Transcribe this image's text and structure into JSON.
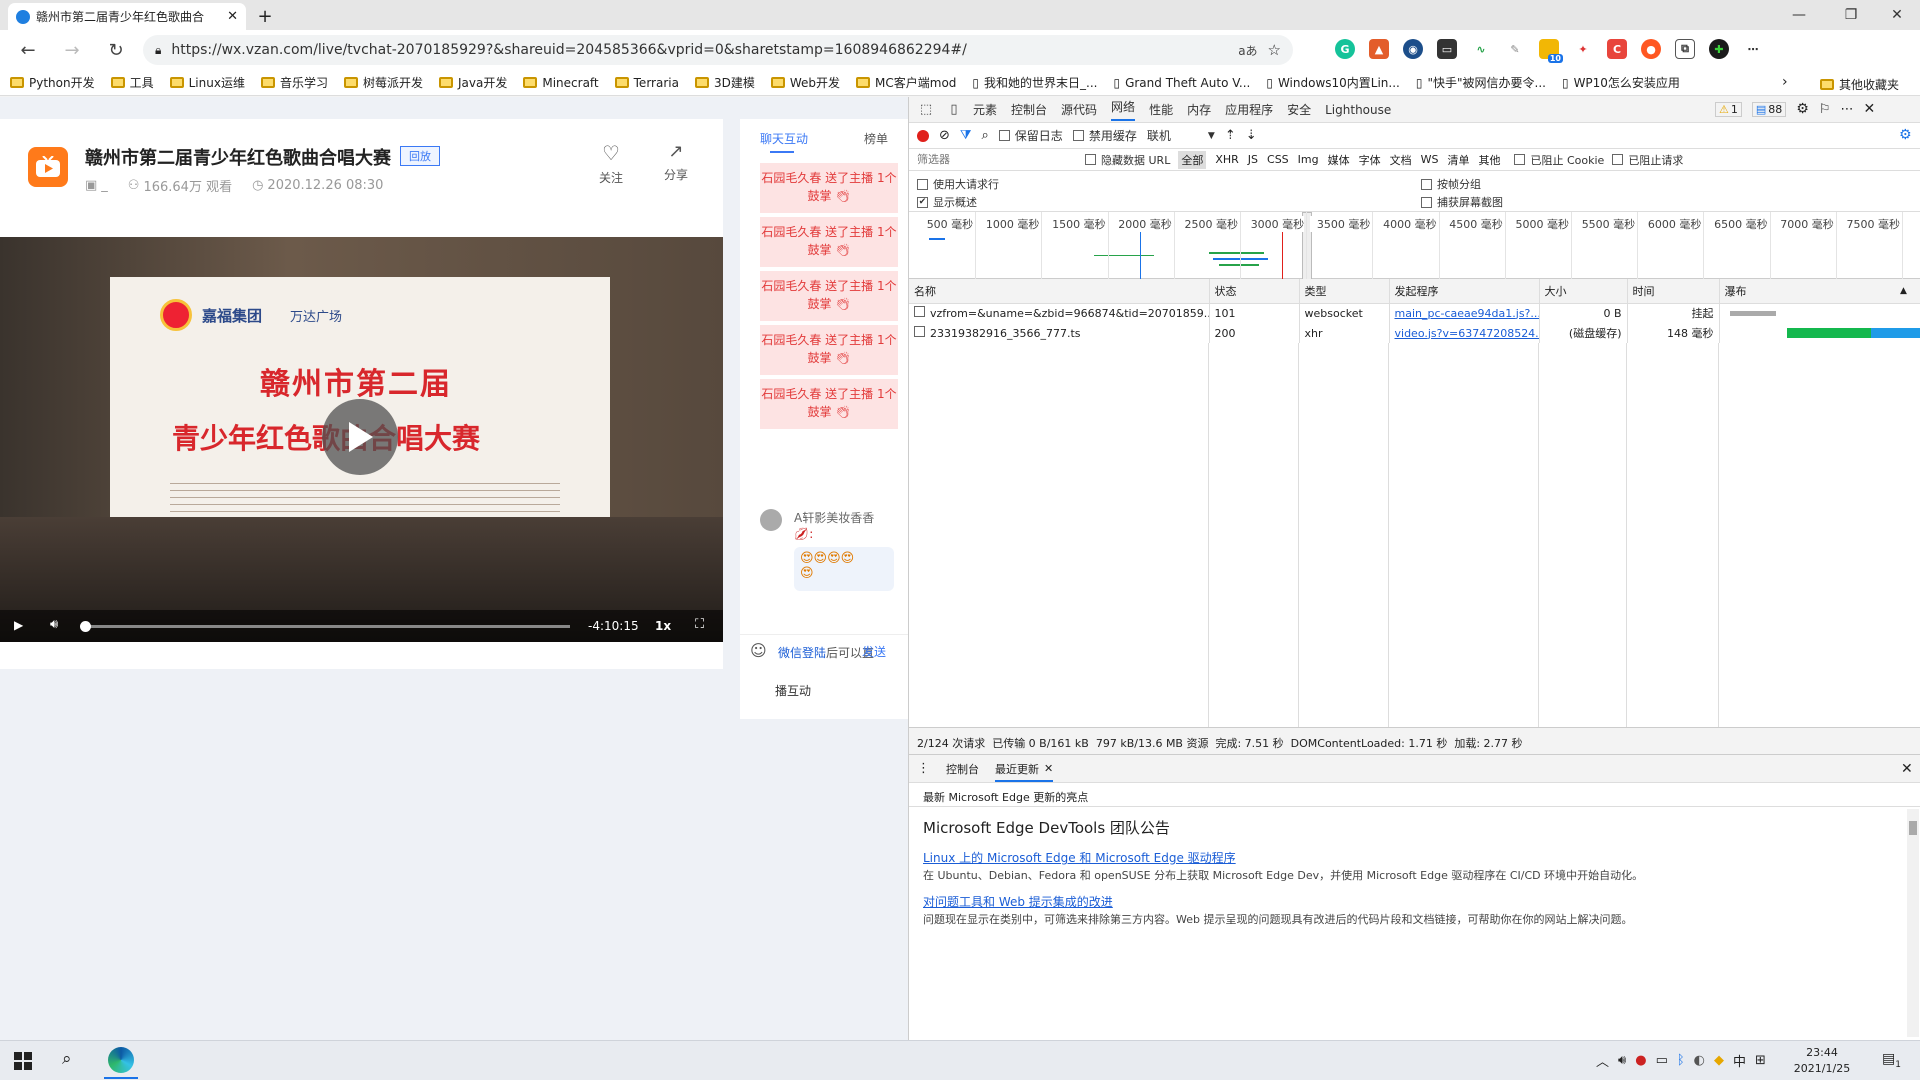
{
  "browser": {
    "tab_title": "赣州市第二届青少年红色歌曲合",
    "url": "https://wx.vzan.com/live/tvchat-2070185929?&shareuid=204585366&vprid=0&sharetstamp=1608946862294#/",
    "bookmarks": [
      "Python开发",
      "工具",
      "Linux运维",
      "音乐学习",
      "树莓派开发",
      "Java开发",
      "Minecraft",
      "Terraria",
      "3D建模",
      "Web开发",
      "MC客户端mod",
      "我和她的世界末日_...",
      "Grand Theft Auto V...",
      "Windows10内置Lin...",
      "\"快手\"被网信办要令...",
      "WP10怎么安装应用"
    ],
    "bookmarks_other": "其他收藏夹",
    "ext_badge": "10",
    "read_icon": "aあ"
  },
  "video_page": {
    "title": "赣州市第二届青少年红色歌曲合唱大赛",
    "badge": "回放",
    "author": "_",
    "views": "166.64万 观看",
    "date": "2020.12.26 08:30",
    "follow": "关注",
    "share": "分享",
    "board_line1": "赣州市第二届",
    "board_line2": "青少年红色歌曲合唱大赛",
    "board_logo1": "嘉福集团",
    "board_logo2": "万达广场",
    "time_left": "-4:10:15",
    "speed": "1x",
    "progress": 0.0
  },
  "chat": {
    "tab_chat": "聊天互动",
    "tab_rank": "榜单",
    "gift_text": "石园毛久春 送了主播 1个 鼓掌",
    "gifts_count": 5,
    "user_name": "A轩影美妆香香",
    "login_prompt": "微信登陆后可以直",
    "login_link": "微信登陆",
    "send": "发送",
    "interaction": "播互动"
  },
  "devtools": {
    "tabs": [
      "元素",
      "控制台",
      "源代码",
      "网络",
      "性能",
      "内存",
      "应用程序",
      "安全",
      "Lighthouse"
    ],
    "active_tab": "网络",
    "warnings": "1",
    "messages": "88",
    "toolbar": {
      "preserve_log": "保留日志",
      "disable_cache": "禁用缓存",
      "throttle": "联机"
    },
    "filter_placeholder": "筛选器",
    "hide_data_url": "隐藏数据 URL",
    "types": [
      "全部",
      "XHR",
      "JS",
      "CSS",
      "Img",
      "媒体",
      "字体",
      "文档",
      "WS",
      "清单",
      "其他"
    ],
    "blocked_cookies": "已阻止 Cookie",
    "blocked_requests": "已阻止请求",
    "large_rows": "使用大请求行",
    "group_by_frame": "按帧分组",
    "show_overview": "显示概述",
    "capture_screenshots": "捕获屏幕截图",
    "timeline_ticks": [
      "500 毫秒",
      "1000 毫秒",
      "1500 毫秒",
      "2000 毫秒",
      "2500 毫秒",
      "3000 毫秒",
      "3500 毫秒",
      "4000 毫秒",
      "4500 毫秒",
      "5000 毫秒",
      "5500 毫秒",
      "6000 毫秒",
      "6500 毫秒",
      "7000 毫秒",
      "7500 毫秒"
    ],
    "columns": [
      "名称",
      "状态",
      "类型",
      "发起程序",
      "大小",
      "时间",
      "瀑布"
    ],
    "rows": [
      {
        "name": "vzfrom=&uname=&zbid=966874&tid=20701859...",
        "status": "101",
        "type": "websocket",
        "initiator": "main_pc-caeae94da1.js?...",
        "size": "0 B",
        "time": "挂起"
      },
      {
        "name": "23319382916_3566_777.ts",
        "status": "200",
        "type": "xhr",
        "initiator": "video.js?v=63747208524...",
        "size": "(磁盘缓存)",
        "time": "148 毫秒"
      }
    ],
    "summary": "2/124 次请求  已传输 0 B/161 kB  797 kB/13.6 MB 资源  完成: 7.51 秒  DOMContentLoaded: 1.71 秒  加载: 2.77 秒",
    "drawer_tabs": [
      "控制台",
      "最近更新"
    ],
    "drawer_active": "最近更新",
    "drawer_header": "最新 Microsoft Edge 更新的亮点",
    "announce_title": "Microsoft Edge DevTools 团队公告",
    "news": [
      {
        "title": "Linux 上的 Microsoft Edge 和 Microsoft Edge 驱动程序",
        "desc": "在 Ubuntu、Debian、Fedora 和 openSUSE 分布上获取 Microsoft Edge Dev，并使用 Microsoft Edge 驱动程序在 CI/CD 环境中开始自动化。"
      },
      {
        "title": "对问题工具和 Web 提示集成的改进",
        "desc": "问题现在显示在类别中，可筛选来排除第三方内容。Web 提示呈现的问题现具有改进后的代码片段和文档链接，可帮助你在你的网站上解决问题。"
      }
    ]
  },
  "taskbar": {
    "time": "23:44",
    "date": "2021/1/25",
    "ime": "中",
    "notif": "1"
  }
}
